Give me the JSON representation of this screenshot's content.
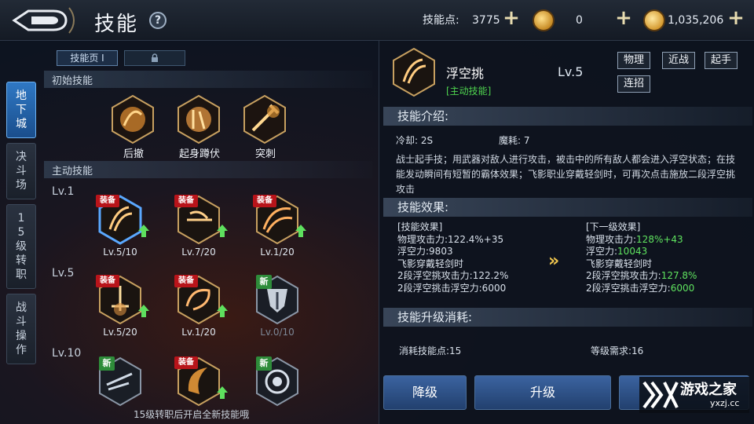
{
  "header": {
    "title": "技能",
    "skill_points_label": "技能点:",
    "skill_points_value": "3775",
    "coin_value": "0",
    "gold_value": "1,035,206"
  },
  "left": {
    "page_tab": "技能页 I",
    "side_tabs": [
      "地下城",
      "决斗场",
      "15级转职",
      "战斗操作"
    ],
    "section_basic": "初始技能",
    "basic_skills": [
      "后撤",
      "起身蹲伏",
      "突刺"
    ],
    "section_active": "主动技能",
    "row_levels": [
      "Lv.1",
      "Lv.5",
      "Lv.10"
    ],
    "badge_equip": "装备",
    "badge_new": "新",
    "row1": [
      "Lv.5/10",
      "Lv.7/20",
      "Lv.1/20"
    ],
    "row2": [
      "Lv.5/20",
      "Lv.1/20",
      "Lv.0/10"
    ],
    "hint": "15级转职后开启全新技能哦"
  },
  "detail": {
    "name": "浮空挑",
    "type": "[主动技能]",
    "level": "Lv.5",
    "tags": [
      "物理",
      "近战",
      "起手",
      "连招"
    ],
    "intro_header": "技能介绍:",
    "cooldown": "冷却: 2S",
    "mana": "魔耗: 7",
    "description": "战士起手技；用武器对敌人进行攻击，被击中的所有敌人都会进入浮空状态；在技能发动瞬间有短暂的霸体效果；飞影职业穿戴轻剑时，可再次点击施放二段浮空挑攻击",
    "effect_header": "技能效果:",
    "cur_title": "[技能效果]",
    "cur_atk_label": "物理攻击力:",
    "cur_atk": "122.4%+35",
    "cur_float_label": "浮空力:",
    "cur_float": "9803",
    "cur_sword": "飞影穿戴轻剑时",
    "cur_second_label": "2段浮空挑攻击力:",
    "cur_second": "122.2%",
    "cur_second_float": "2段浮空挑击浮空力:6000",
    "next_title": "[下一级效果]",
    "next_atk_label": "物理攻击力:",
    "next_atk": "128%+43",
    "next_float_label": "浮空力:",
    "next_float": "10043",
    "next_sword": "飞影穿戴轻剑时",
    "next_second_label": "2段浮空挑攻击力:",
    "next_second": "127.8%",
    "next_second_float_label": "2段浮空挑击浮空力:",
    "next_second_float": "6000",
    "upgrade_header": "技能升级消耗:",
    "cost": "消耗技能点:15",
    "level_req": "等级需求:16"
  },
  "buttons": {
    "downgrade": "降级",
    "upgrade": "升级"
  },
  "watermark": {
    "brand": "游戏之家",
    "url": "yxzj.cc"
  },
  "colors": {
    "accent_green": "#5fe35f",
    "equip_red": "#b8141a",
    "gold": "#f0c64e"
  }
}
